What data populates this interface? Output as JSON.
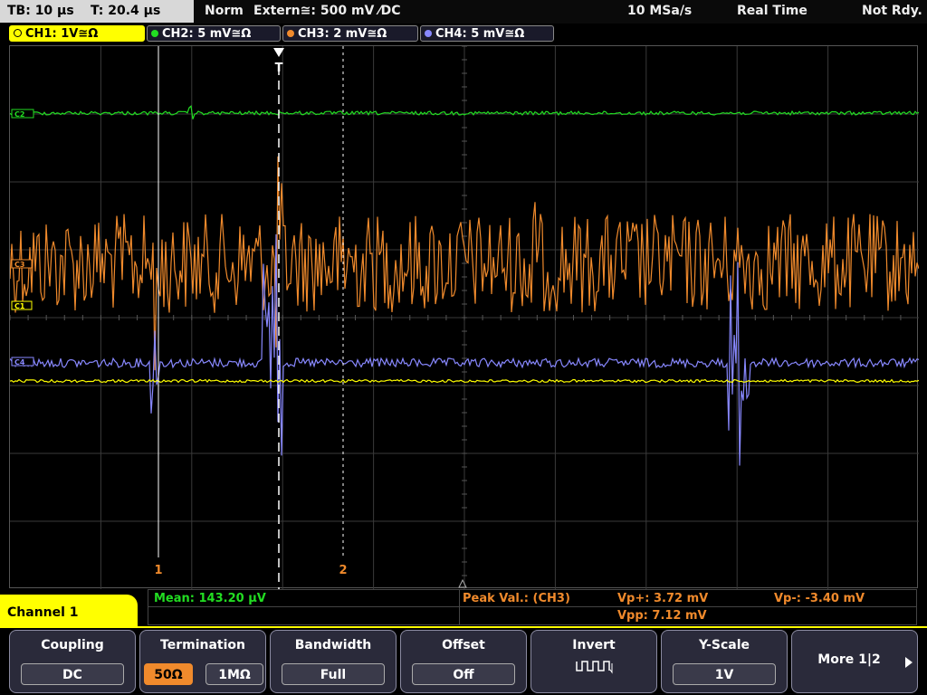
{
  "topbar": {
    "timebase": "TB: 10 µs",
    "trigger_time": "T: 20.4 µs",
    "trigger_mode": "Norm",
    "trigger_source": "Extern≅: 500 mV ⁄DC",
    "sample_rate": "10 MSa/s",
    "acq_mode": "Real Time",
    "status": "Not Rdy."
  },
  "channels": [
    {
      "label": "CH1: 1V≅Ω",
      "color": "#ffff00"
    },
    {
      "label": "CH2: 5 mV≅Ω",
      "color": "#22dd22"
    },
    {
      "label": "CH3: 2 mV≅Ω",
      "color": "#f08a2c"
    },
    {
      "label": "CH4: 5 mV≅Ω",
      "color": "#8888ff"
    }
  ],
  "screen": {
    "trigger_marker": "T",
    "cursor1_label": "1",
    "cursor2_label": "2",
    "ch2_marker": "C2",
    "ch3_marker": "C3",
    "ch1_marker": "C1",
    "ch4_marker": "C4"
  },
  "measurements": {
    "mean": "Mean: 143.20 µV",
    "peak_title": "Peak Val.:  (CH3)",
    "vp_plus": "Vp+: 3.72 mV",
    "vp_minus": "Vp-: -3.40 mV",
    "vpp": "Vpp: 7.12 mV"
  },
  "menu_title": "Channel 1",
  "softkeys": {
    "coupling": {
      "label": "Coupling",
      "value": "DC"
    },
    "termination": {
      "label": "Termination",
      "opt1": "50Ω",
      "opt2": "1MΩ"
    },
    "bandwidth": {
      "label": "Bandwidth",
      "value": "Full"
    },
    "offset": {
      "label": "Offset",
      "value": "Off"
    },
    "invert": {
      "label": "Invert"
    },
    "yscale": {
      "label": "Y-Scale",
      "value": "1V"
    },
    "more": {
      "label": "More 1|2"
    }
  }
}
